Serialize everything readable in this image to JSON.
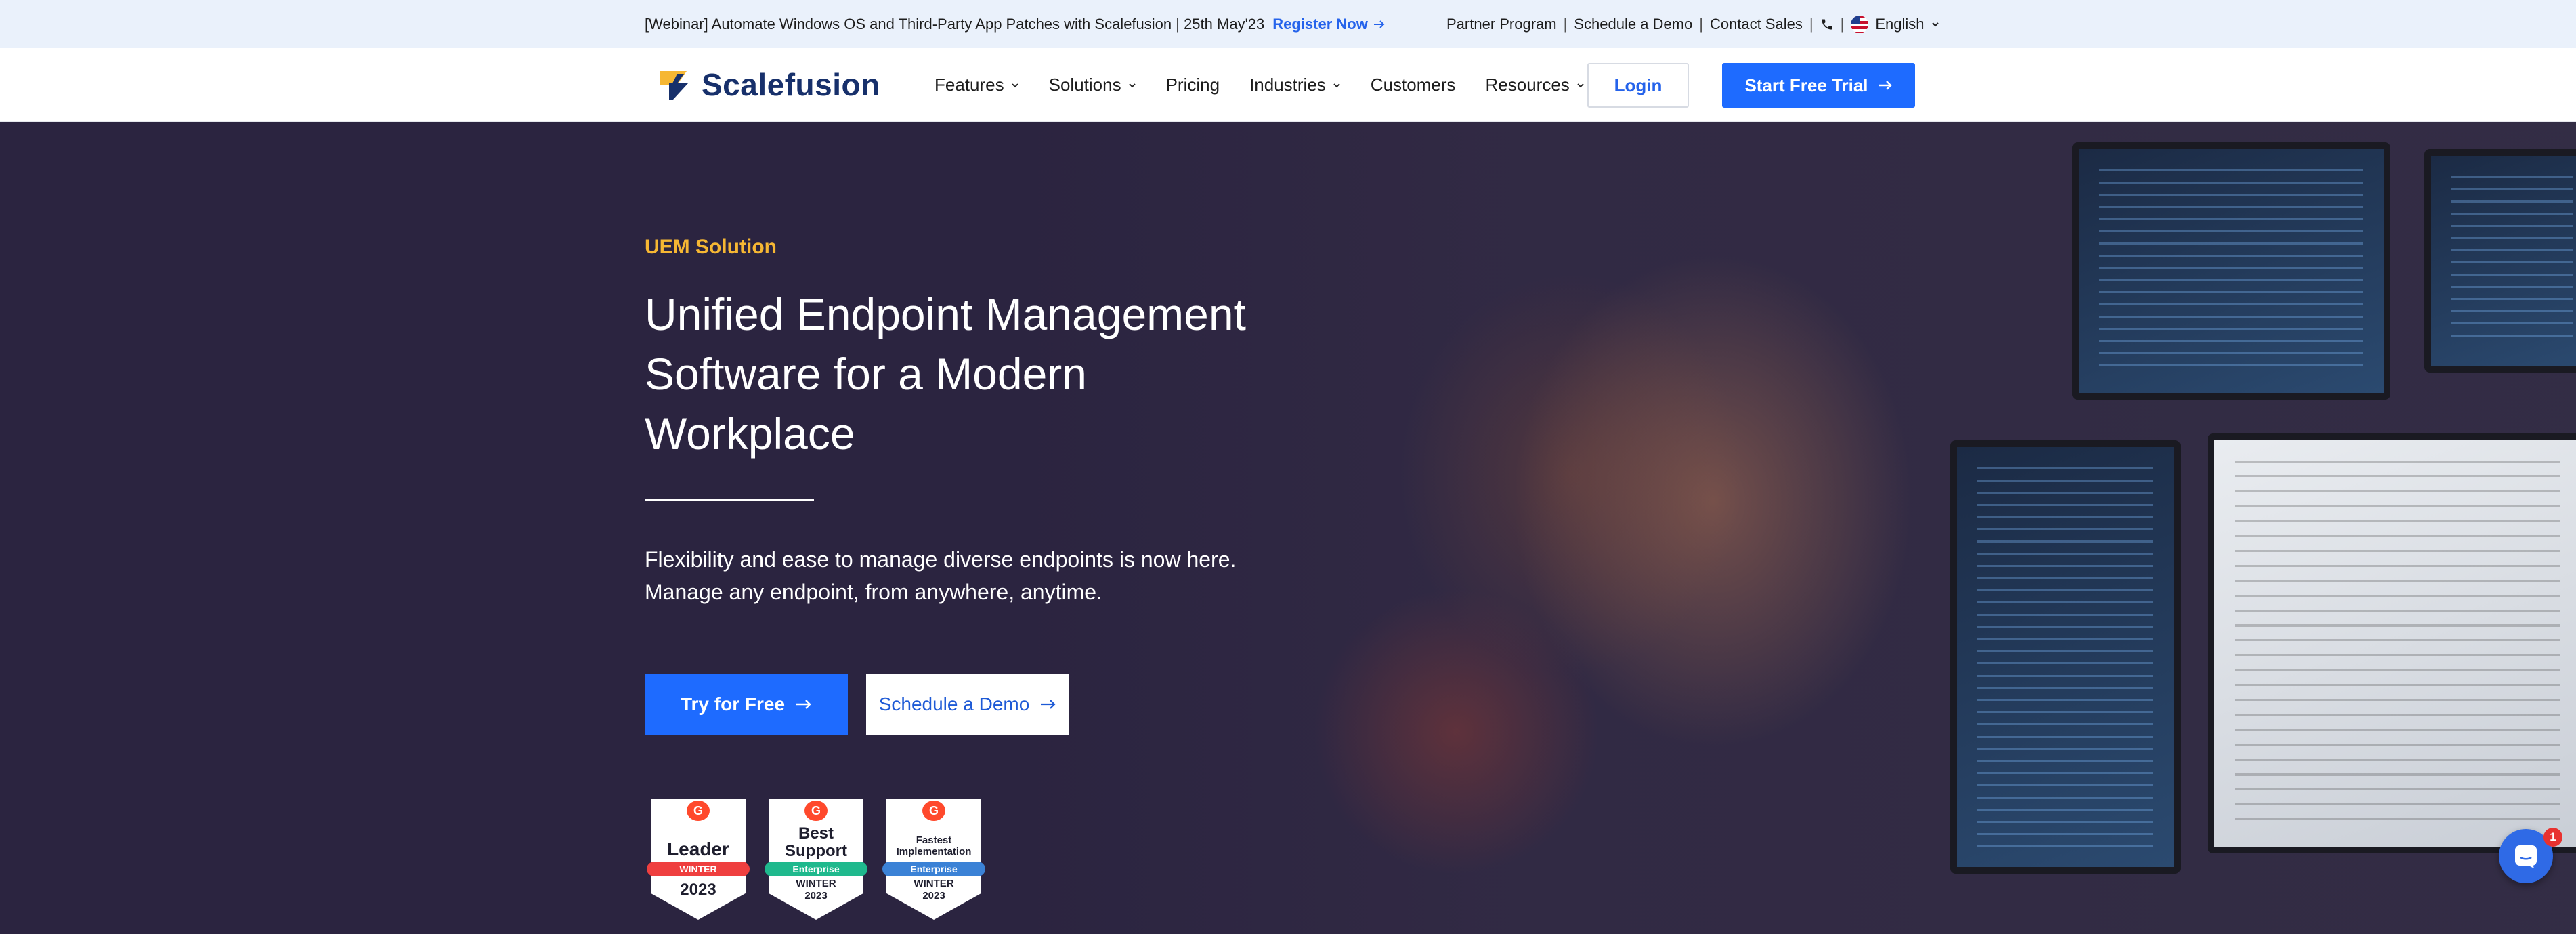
{
  "topbar": {
    "promo_text": "[Webinar] Automate Windows OS and Third-Party App Patches with Scalefusion | 25th May'23",
    "register_label": "Register Now",
    "links": [
      "Partner Program",
      "Schedule a Demo",
      "Contact Sales"
    ],
    "language": "English"
  },
  "nav": {
    "brand": "Scalefusion",
    "items": [
      {
        "label": "Features",
        "dropdown": true
      },
      {
        "label": "Solutions",
        "dropdown": true
      },
      {
        "label": "Pricing",
        "dropdown": false
      },
      {
        "label": "Industries",
        "dropdown": true
      },
      {
        "label": "Customers",
        "dropdown": false
      },
      {
        "label": "Resources",
        "dropdown": true
      }
    ],
    "login_label": "Login",
    "trial_label": "Start Free Trial"
  },
  "hero": {
    "eyebrow": "UEM Solution",
    "headline": "Unified Endpoint Management Software for a Modern Workplace",
    "subtext_line1": "Flexibility and ease to manage diverse endpoints is now here.",
    "subtext_line2": "Manage any endpoint, from anywhere, anytime.",
    "try_label": "Try for Free",
    "demo_label": "Schedule a Demo"
  },
  "badges": [
    {
      "title": "Leader",
      "ribbon": "WINTER",
      "season": "2023",
      "ribbon_color": "#ef3f3f"
    },
    {
      "title_line1": "Best",
      "title_line2": "Support",
      "ribbon": "Enterprise",
      "season_line1": "WINTER",
      "season_line2": "2023",
      "ribbon_color": "#1fb98d"
    },
    {
      "title_line1": "Fastest",
      "title_line2": "Implementation",
      "ribbon": "Enterprise",
      "season_line1": "WINTER",
      "season_line2": "2023",
      "ribbon_color": "#3b82d6"
    }
  ],
  "chat": {
    "unread_count": "1"
  },
  "colors": {
    "accent": "#1e6bff",
    "eyebrow": "#f6b733",
    "hero_bg": "#2b2440",
    "topbar_bg": "#eaf1fb"
  }
}
